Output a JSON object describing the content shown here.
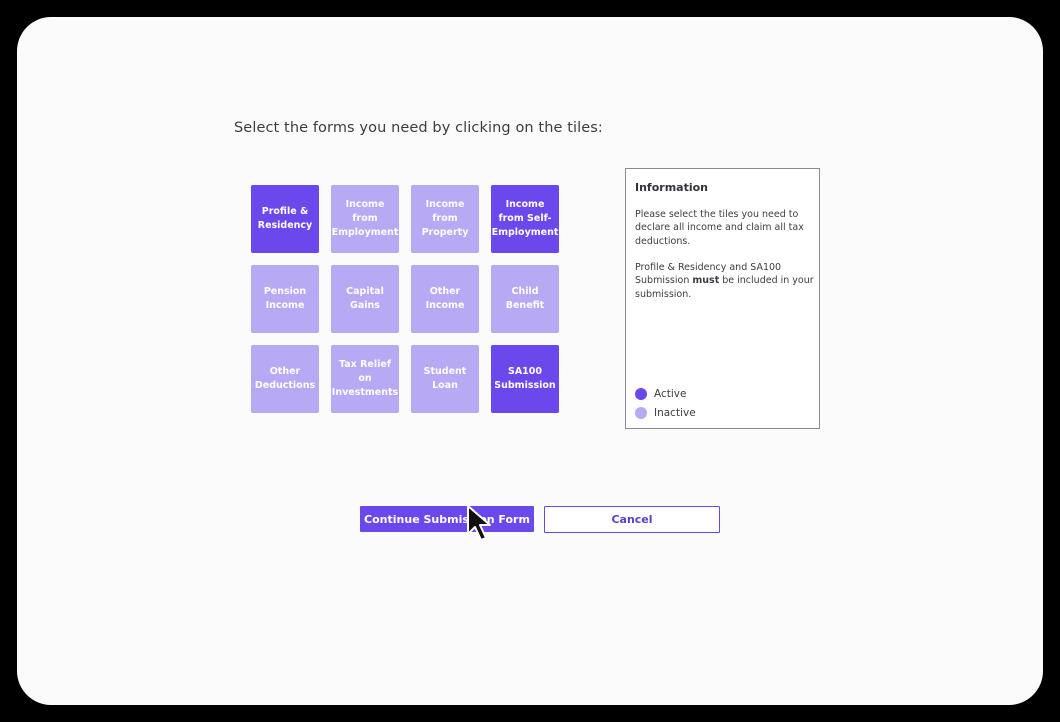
{
  "instruction": "Select the forms you need by clicking on the tiles:",
  "tiles": [
    {
      "label": "Profile & Residency",
      "state": "active"
    },
    {
      "label": "Income from Employment",
      "state": "inactive"
    },
    {
      "label": "Income from Property",
      "state": "inactive"
    },
    {
      "label": "Income from Self-Employment",
      "state": "active"
    },
    {
      "label": "Pension Income",
      "state": "inactive"
    },
    {
      "label": "Capital Gains",
      "state": "inactive"
    },
    {
      "label": "Other Income",
      "state": "inactive"
    },
    {
      "label": "Child Benefit",
      "state": "inactive"
    },
    {
      "label": "Other Deductions",
      "state": "inactive"
    },
    {
      "label": "Tax Relief on Investments",
      "state": "inactive"
    },
    {
      "label": "Student Loan",
      "state": "inactive"
    },
    {
      "label": "SA100 Submission",
      "state": "active"
    }
  ],
  "info": {
    "title": "Information",
    "p1": "Please select the tiles you need to declare all income and claim all tax deductions.",
    "p2_before": "Profile & Residency and SA100 Submission ",
    "p2_bold": "must",
    "p2_after": " be included in your submission.",
    "legend_active": "Active",
    "legend_inactive": "Inactive"
  },
  "buttons": {
    "continue": "Continue Submission Form",
    "cancel": "Cancel"
  },
  "colors": {
    "active": "#6a48ec",
    "inactive": "#b8a9f5"
  },
  "icons": {
    "cursor": "mouse-pointer-icon"
  }
}
